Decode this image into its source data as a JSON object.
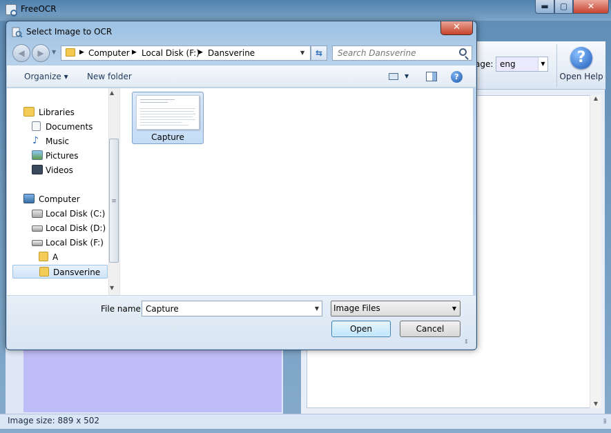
{
  "main_window": {
    "title": "FreeOCR",
    "caption": {
      "minimize": "▬",
      "maximize": "▢",
      "close": "✕"
    },
    "language_label": "age:",
    "language_value": "eng",
    "help_button": "Open Help",
    "status": "Image size:  889 x  502"
  },
  "dialog": {
    "title": "Select Image to OCR",
    "close": "✕",
    "address": {
      "crumbs": [
        "Computer",
        "Local Disk (F:)",
        "Dansverine"
      ]
    },
    "search_placeholder": "Search Dansverine",
    "toolbar": {
      "organize": "Organize ▾",
      "new_folder": "New folder",
      "help": "?"
    },
    "nav": {
      "libraries": "Libraries",
      "documents": "Documents",
      "music": "Music",
      "pictures": "Pictures",
      "videos": "Videos",
      "computer": "Computer",
      "disk_c": "Local Disk (C:)",
      "disk_d": "Local Disk (D:)",
      "disk_f": "Local Disk (F:)",
      "folder_a": "A",
      "folder_dansverine": "Dansverine"
    },
    "files": [
      {
        "name": "Capture"
      }
    ],
    "file_name_label": "File name:",
    "file_name_value": "Capture",
    "file_type": "Image Files",
    "open_button": "Open",
    "cancel_button": "Cancel"
  },
  "colors": {
    "accent": "#3c7fb1",
    "close_red": "#c5432c",
    "selection": "#cfe3f8"
  }
}
